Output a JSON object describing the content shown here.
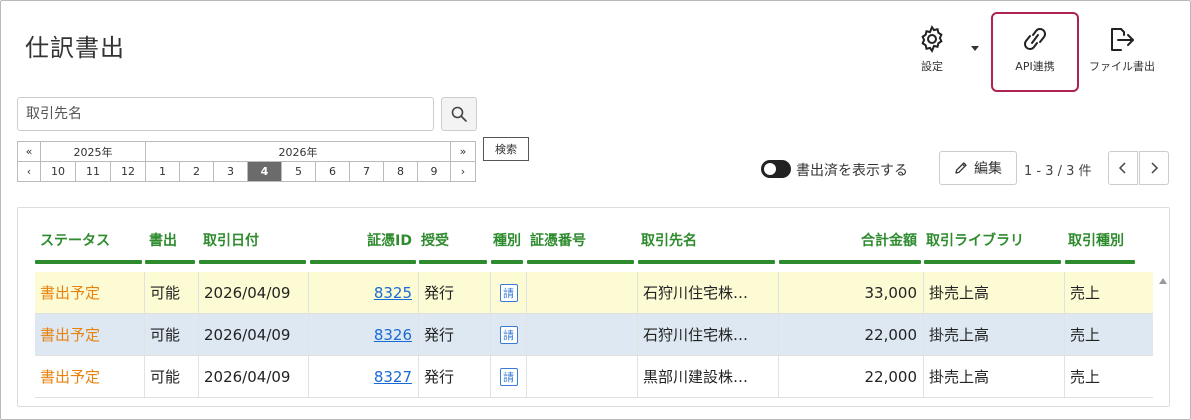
{
  "header": {
    "title": "仕訳書出"
  },
  "toolbar": {
    "settings_label": "設定",
    "api_label": "API連携",
    "export_label": "ファイル書出"
  },
  "search": {
    "placeholder": "取引先名",
    "tooltip": "検索"
  },
  "datenav": {
    "year_prev": "2025年",
    "year_next": "2026年",
    "months_prev": [
      "10",
      "11",
      "12"
    ],
    "months_next": [
      "1",
      "2",
      "3",
      "4",
      "5",
      "6",
      "7",
      "8",
      "9"
    ],
    "active_month": "4",
    "fast_prev": "«",
    "fast_next": "»",
    "prev": "‹",
    "next": "›"
  },
  "controls": {
    "toggle_label": "書出済を表示する",
    "edit_label": "編集",
    "page_info": "1 - 3 / 3 件"
  },
  "table": {
    "columns": [
      "ステータス",
      "書出",
      "取引日付",
      "証憑ID",
      "授受",
      "種別",
      "証憑番号",
      "取引先名",
      "合計金額",
      "取引ライブラリ",
      "取引種別"
    ],
    "rows": [
      {
        "status": "書出予定",
        "export": "可能",
        "date": "2026/04/09",
        "voucher_id": "8325",
        "give_receive": "発行",
        "kind": "請",
        "voucher_no": "",
        "partner": "石狩川住宅株…",
        "amount": "33,000",
        "library": "掛売上高",
        "trans_type": "売上"
      },
      {
        "status": "書出予定",
        "export": "可能",
        "date": "2026/04/09",
        "voucher_id": "8326",
        "give_receive": "発行",
        "kind": "請",
        "voucher_no": "",
        "partner": "石狩川住宅株…",
        "amount": "22,000",
        "library": "掛売上高",
        "trans_type": "売上"
      },
      {
        "status": "書出予定",
        "export": "可能",
        "date": "2026/04/09",
        "voucher_id": "8327",
        "give_receive": "発行",
        "kind": "請",
        "voucher_no": "",
        "partner": "黒部川建設株…",
        "amount": "22,000",
        "library": "掛売上高",
        "trans_type": "売上"
      }
    ]
  },
  "colors": {
    "accent_green": "#2e8b2e",
    "status_orange": "#e8820e",
    "highlight_border": "#b0234e",
    "link_blue": "#1a6ad6"
  }
}
